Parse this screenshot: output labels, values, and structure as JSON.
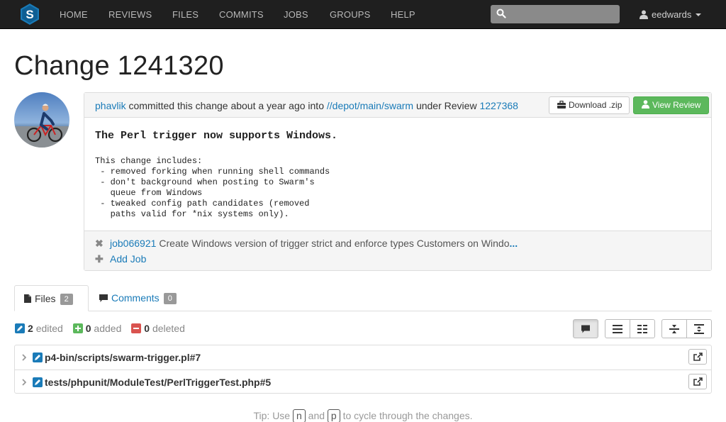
{
  "nav": {
    "items": [
      "HOME",
      "REVIEWS",
      "FILES",
      "COMMITS",
      "JOBS",
      "GROUPS",
      "HELP"
    ],
    "search_placeholder": "",
    "user": "eedwards"
  },
  "page_title": "Change 1241320",
  "change": {
    "author": "phavlik",
    "committed_text": "committed this change about a year ago into",
    "path": "//depot/main/swarm",
    "under_review_text": "under Review",
    "review_id": "1227368",
    "download_label": "Download .zip",
    "view_review_label": "View Review",
    "description_title": "The Perl trigger now supports Windows.",
    "description_body": "This change includes:\n - removed forking when running shell commands\n - don't background when posting to Swarm's\n   queue from Windows\n - tweaked config path candidates (removed\n   paths valid for *nix systems only)."
  },
  "jobs": {
    "items": [
      {
        "id": "job066921",
        "description": "Create Windows version of trigger strict and enforce types Customers on Windo",
        "ellipsis": "..."
      }
    ],
    "add_label": "Add Job"
  },
  "tabs": {
    "files": {
      "label": "Files",
      "count": "2"
    },
    "comments": {
      "label": "Comments",
      "count": "0"
    }
  },
  "stats": {
    "edited_count": "2",
    "edited_label": "edited",
    "added_count": "0",
    "added_label": "added",
    "deleted_count": "0",
    "deleted_label": "deleted"
  },
  "files": [
    {
      "name": "p4-bin/scripts/swarm-trigger.pl#7"
    },
    {
      "name": "tests/phpunit/ModuleTest/PerlTriggerTest.php#5"
    }
  ],
  "tip": {
    "prefix": "Tip: Use",
    "key1": "n",
    "and": "and",
    "key2": "p",
    "suffix": "to cycle through the changes."
  },
  "colors": {
    "navbar": "#1f1f1f",
    "link": "#1a7bb8",
    "success": "#5cb85c",
    "edited": "#1a7bb8",
    "added": "#5cb85c",
    "deleted": "#d9534f"
  },
  "icons": [
    "swarm-logo",
    "search-icon",
    "user-icon",
    "briefcase-icon",
    "user-icon",
    "remove-icon",
    "plus-icon",
    "file-icon",
    "comment-icon",
    "edit-icon",
    "add-icon",
    "delete-icon",
    "comments-toggle-icon",
    "list-icon",
    "columns-icon",
    "collapse-icon",
    "expand-icon",
    "chevron-right-icon",
    "open-icon"
  ]
}
